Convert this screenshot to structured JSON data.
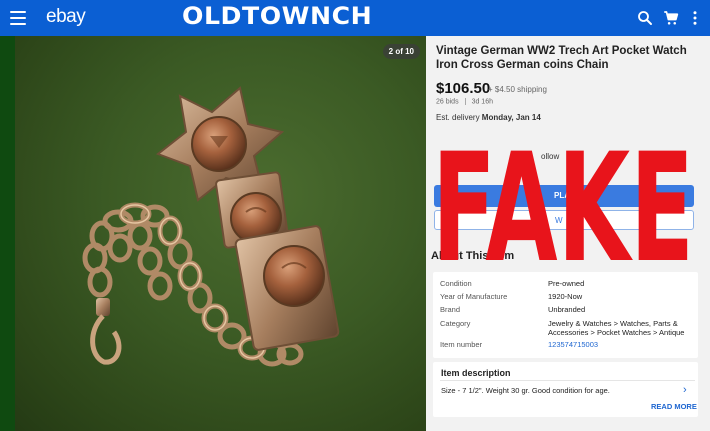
{
  "header": {
    "brand": "ebay",
    "banner_text": "OLDTOWNCH",
    "icons": [
      "menu-icon",
      "search-icon",
      "cart-icon",
      "more-vert-icon"
    ]
  },
  "photo": {
    "counter": "2 of 10"
  },
  "listing": {
    "title": "Vintage German WW2  Trech Art Pocket Watch  Iron Cross German coins Chain",
    "price": "$106.50",
    "shipping": "+ $4.50 shipping",
    "bids": "26 bids",
    "time_left": "3d 16h",
    "delivery_label": "Est. delivery ",
    "delivery_date": "Monday, Jan 14",
    "follow_fragment": "ollow",
    "bid_fragment": "PLA",
    "watch_fragment": "W"
  },
  "overlay": {
    "stamp_text": "FAKE",
    "color": "#e8141b"
  },
  "about": {
    "heading": "About This Item",
    "rows": [
      {
        "label": "Condition",
        "value": "Pre-owned"
      },
      {
        "label": "Year of Manufacture",
        "value": "1920-Now"
      },
      {
        "label": "Brand",
        "value": "Unbranded"
      },
      {
        "label": "Category",
        "value": "Jewelry & Watches > Watches, Parts & Accessories > Pocket Watches > Antique"
      },
      {
        "label": "Item number",
        "value": "123574715003"
      }
    ]
  },
  "description": {
    "heading": "Item description",
    "text": "Size - 7 1/2\". Weight 30 gr. Good condition for age.",
    "read_more": "READ MORE"
  },
  "colors": {
    "header_bg": "#0b5fd3",
    "link": "#1e66d0"
  }
}
